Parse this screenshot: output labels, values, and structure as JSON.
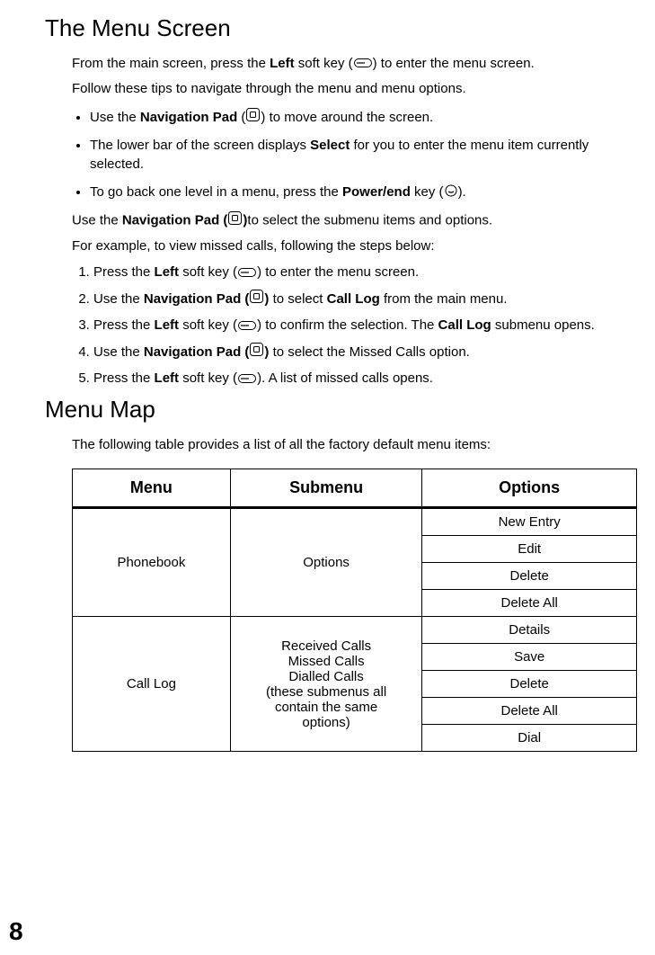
{
  "page_number": "8",
  "heading1": "The Menu Screen",
  "intro1a": "From the main screen, press the ",
  "intro1_left": "Left",
  "intro1b": " soft key (",
  "intro1c": ") to enter the menu screen.",
  "intro2": "Follow these tips to navigate through the menu and menu options.",
  "bullet1a": "Use the ",
  "bullet1_navpad": "Navigation Pad",
  "bullet1b": " (",
  "bullet1c": ") to move around the screen.",
  "bullet2a": "The lower bar of the screen displays ",
  "bullet2_select": "Select",
  "bullet2b": " for you to enter the menu item currently selected.",
  "bullet3a": "To go back one level in a menu, press the ",
  "bullet3_power": "Power/end",
  "bullet3b": " key (",
  "bullet3c": ").",
  "para_navpad_a": "Use the ",
  "para_navpad_bold": "Navigation Pad (",
  "para_navpad_bold2": ")",
  "para_navpad_b": "to select the submenu items and options.",
  "example_intro": "For example, to view missed calls, following the steps below:",
  "step1a": "Press the ",
  "step1_left": "Left",
  "step1b": " soft key (",
  "step1c": ") to enter the menu screen.",
  "step2a": "Use the ",
  "step2_navpad": "Navigation Pad (",
  "step2_navpad2": ")",
  "step2b": " to select ",
  "step2_calllog": "Call Log",
  "step2c": " from the main menu.",
  "step3a": "Press the ",
  "step3_left": "Left",
  "step3b": " soft key (",
  "step3c": ") to confirm the selection. The ",
  "step3_calllog": "Call Log",
  "step3d": " submenu opens.",
  "step4a": "Use the ",
  "step4_navpad": "Navigation Pad (",
  "step4_navpad2": ")",
  "step4b": " to select the Missed Calls option.",
  "step5a": "Press the ",
  "step5_left": "Left",
  "step5b": " soft key (",
  "step5c": "). A list of missed calls opens.",
  "heading2": "Menu Map",
  "table_intro": "The following table provides a list of all the factory default menu items:",
  "th_menu": "Menu",
  "th_submenu": "Submenu",
  "th_options": "Options",
  "r1_menu": "Phonebook",
  "r1_submenu": "Options",
  "r1_opt1": "New Entry",
  "r1_opt2": "Edit",
  "r1_opt3": "Delete",
  "r1_opt4": "Delete All",
  "r2_menu": "Call Log",
  "r2_sub_l1": "Received Calls",
  "r2_sub_l2": "Missed Calls",
  "r2_sub_l3": "Dialled Calls",
  "r2_sub_l4": "(these submenus all",
  "r2_sub_l5": "contain the same",
  "r2_sub_l6": "options)",
  "r2_opt1": "Details",
  "r2_opt2": "Save",
  "r2_opt3": "Delete",
  "r2_opt4": "Delete All",
  "r2_opt5": "Dial"
}
